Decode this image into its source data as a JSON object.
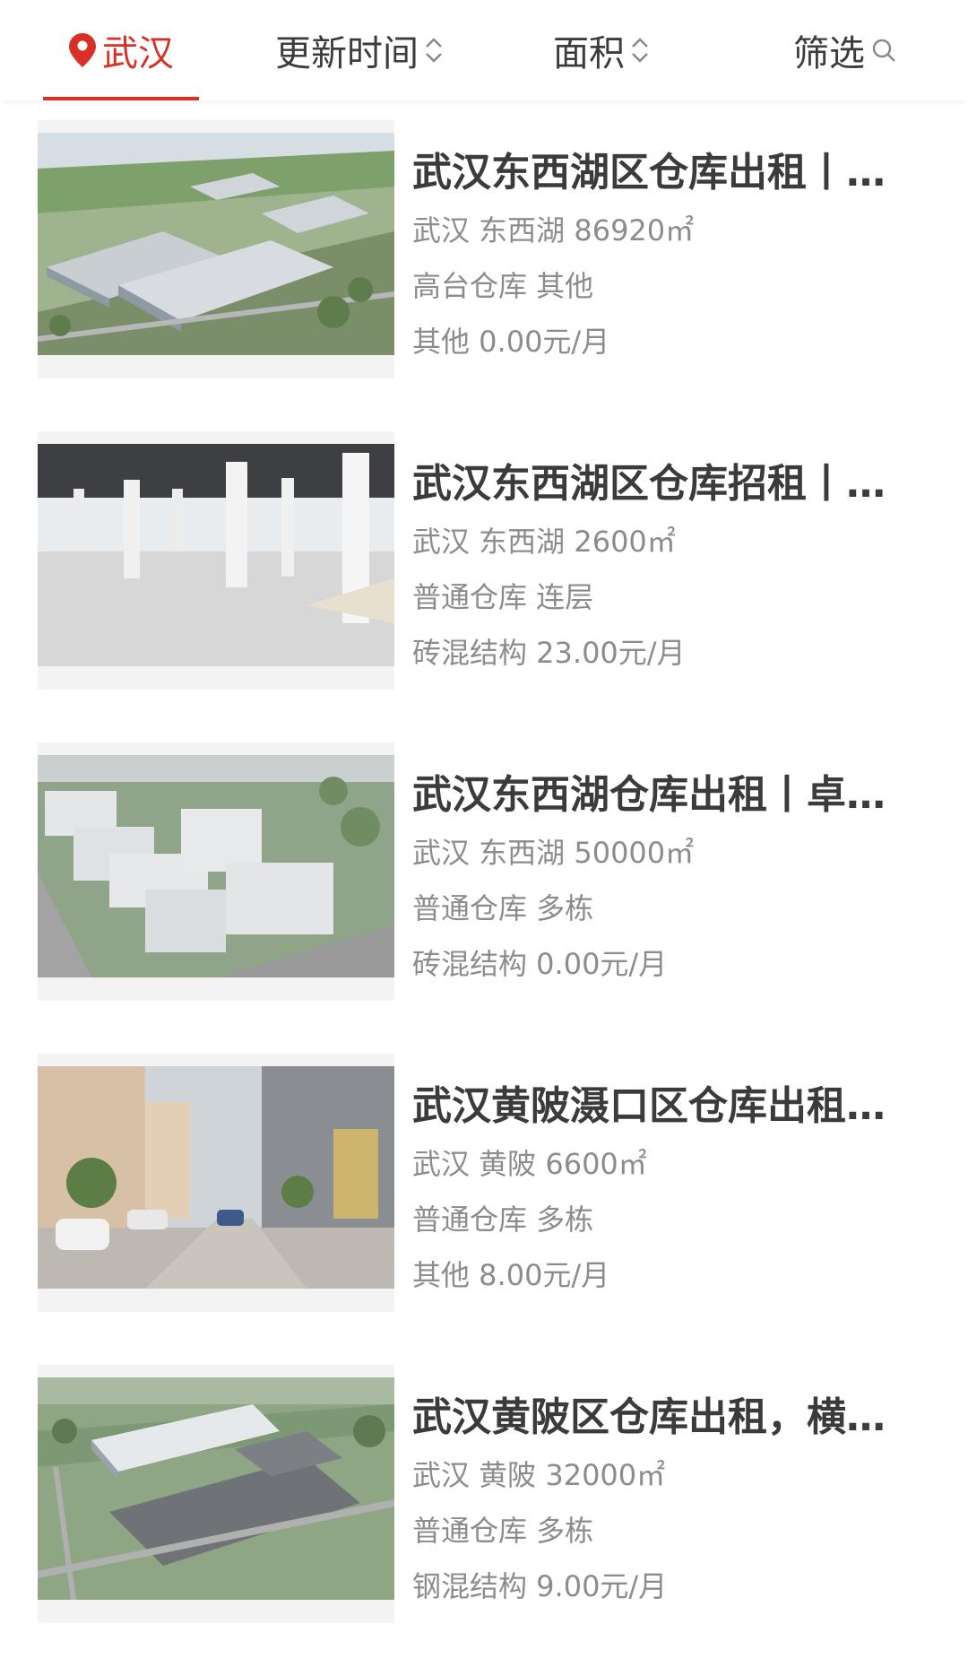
{
  "filters": {
    "city": "武汉",
    "update_time": "更新时间",
    "area": "面积",
    "filter": "筛选"
  },
  "listings": [
    {
      "title": "武汉东西湖区仓库出租丨…",
      "location": "武汉 东西湖 86920㎡",
      "category": "高台仓库 其他",
      "price": "其他 0.00元/月"
    },
    {
      "title": "武汉东西湖区仓库招租丨…",
      "location": "武汉 东西湖 2600㎡",
      "category": "普通仓库 连层",
      "price": "砖混结构 23.00元/月"
    },
    {
      "title": "武汉东西湖仓库出租丨卓…",
      "location": "武汉 东西湖 50000㎡",
      "category": "普通仓库 多栋",
      "price": "砖混结构 0.00元/月"
    },
    {
      "title": "武汉黄陂滠口区仓库出租…",
      "location": "武汉 黄陂 6600㎡",
      "category": "普通仓库 多栋",
      "price": "其他 8.00元/月"
    },
    {
      "title": "武汉黄陂区仓库出租，横…",
      "location": "武汉 黄陂 32000㎡",
      "category": "普通仓库 多栋",
      "price": "钢混结构 9.00元/月"
    }
  ],
  "colors": {
    "accent": "#d93025",
    "title": "#3b3b3b",
    "meta": "#8c8c8c"
  },
  "icons": {
    "city": "location-pin-icon",
    "sort": "sort-arrows-icon",
    "filter": "search-icon"
  }
}
